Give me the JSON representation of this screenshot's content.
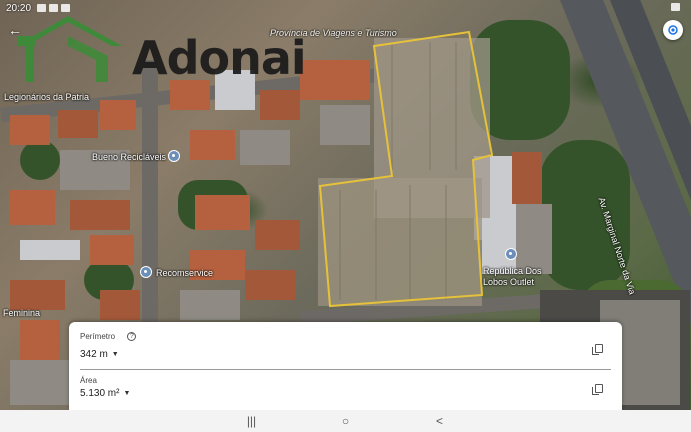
{
  "status_bar": {
    "time": "20:20"
  },
  "watermark": {
    "brand": "Adonai"
  },
  "map": {
    "labels": {
      "street_legionarios": "Legionários da Patria",
      "bueno": "Bueno Recicláveis",
      "recomservice": "Recomservice",
      "republica": "República Dos Lobos Outlet",
      "feminina": "Feminina",
      "avenue": "Av. Marginal Norte da Via",
      "provincia": "Província de Viagens e Turismo"
    }
  },
  "measurement": {
    "perimeter_label": "Perímetro",
    "perimeter_value": "342 m",
    "area_label": "Área",
    "area_value": "5.130 m²"
  },
  "nav": {
    "recent": "|||",
    "home": "○",
    "back": "<"
  }
}
